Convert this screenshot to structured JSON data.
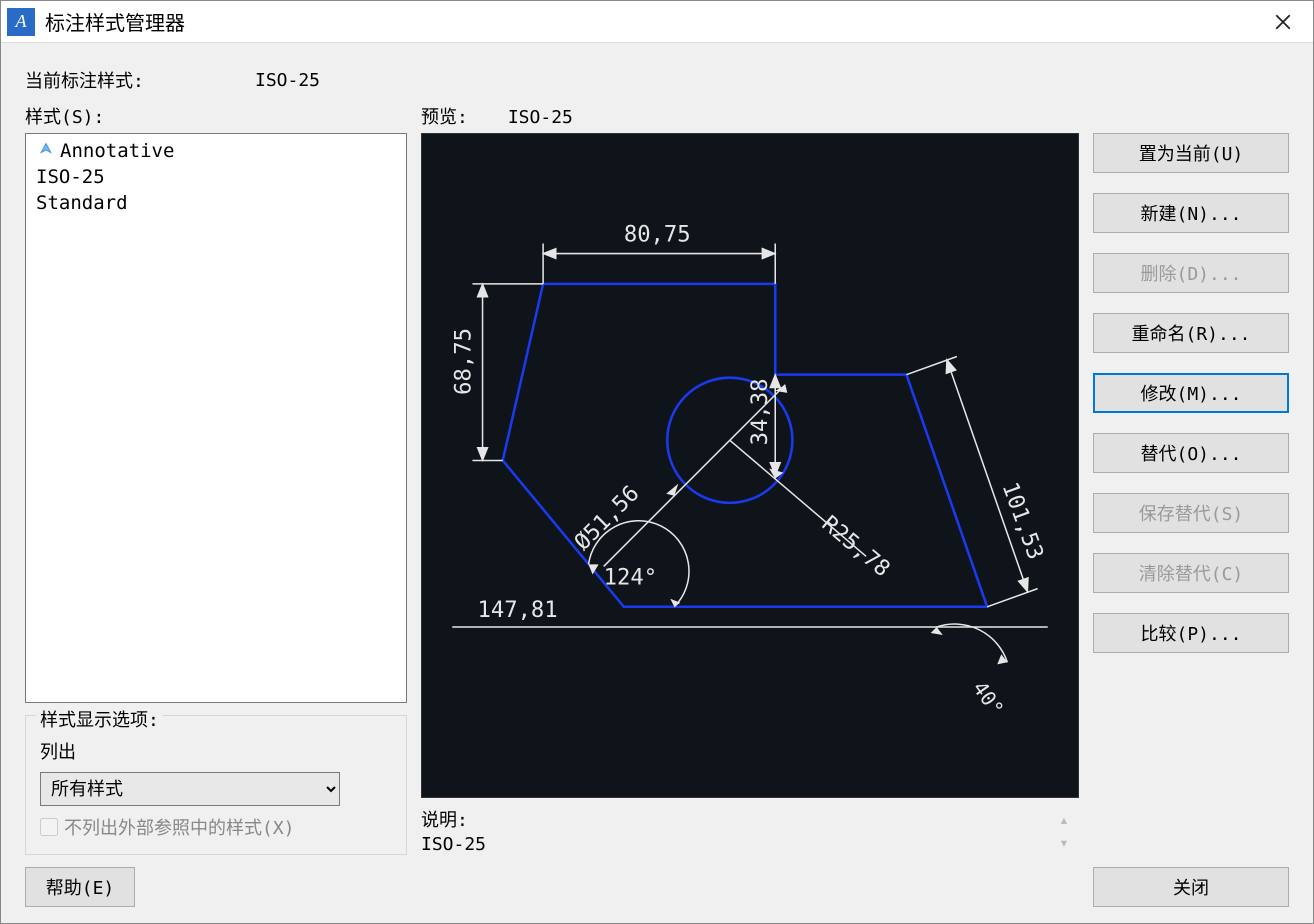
{
  "window": {
    "title": "标注样式管理器"
  },
  "current": {
    "label": "当前标注样式:",
    "value": "ISO-25"
  },
  "styles": {
    "label": "样式(S):",
    "items": [
      "Annotative",
      "ISO-25",
      "Standard"
    ]
  },
  "display_group": {
    "title": "样式显示选项:",
    "list_label": "列出",
    "combo_value": "所有样式",
    "checkbox_label": "不列出外部参照中的样式(X)"
  },
  "preview": {
    "label": "预览:",
    "value": "ISO-25",
    "dims": {
      "d80": "80,75",
      "d68": "68,75",
      "d147": "147,81",
      "d34": "34,38",
      "d51": "51,56",
      "d124": "124°",
      "r25": "R25,78",
      "d101": "101,53",
      "d40": "40°",
      "dia_prefix": "Ø"
    }
  },
  "description": {
    "label": "说明:",
    "value": "ISO-25"
  },
  "buttons": {
    "set_current": "置为当前(U)",
    "new": "新建(N)...",
    "delete": "删除(D)...",
    "rename": "重命名(R)...",
    "modify": "修改(M)...",
    "override": "替代(O)...",
    "save_override": "保存替代(S)",
    "clear_override": "清除替代(C)",
    "compare": "比较(P)...",
    "help": "帮助(E)",
    "close": "关闭"
  }
}
